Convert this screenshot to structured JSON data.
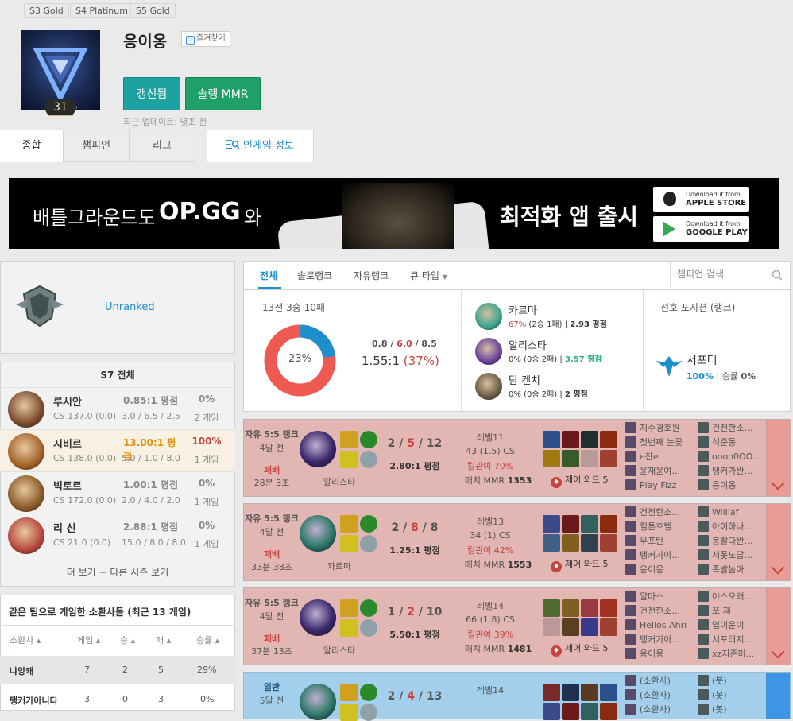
{
  "tier_tags": [
    "S3 Gold",
    "S4 Platinum",
    "S5 Gold"
  ],
  "profile": {
    "level": "31",
    "name": "응이옹",
    "favorite_label": "즐겨찾기",
    "refresh_label": "갱신됨",
    "mmr_label": "솔랭 MMR",
    "last_update": "최근 업데이트: 몇초 전"
  },
  "tabs": [
    "종합",
    "챔피언",
    "리그",
    "인게임 정보"
  ],
  "banner": {
    "text1": "배틀그라운드도",
    "text2": "OP.GG",
    "text3": "와",
    "text4": "최적화 앱 출시",
    "apple_small": "Download it from",
    "apple_big": "APPLE STORE",
    "google_small": "Download it from",
    "google_big": "GOOGLE PLAY"
  },
  "rank": {
    "status": "Unranked"
  },
  "season": {
    "title": "S7 전체",
    "champions": [
      {
        "name": "루시안",
        "cs": "CS 137.0 (0.0)",
        "kda": "0.85:1 평점",
        "kd": "3.0 / 6.5 / 2.5",
        "winrate": "0%",
        "games": "2 게임",
        "kda_color": "#888",
        "wr_color": "#888",
        "face": "#7a4a2e"
      },
      {
        "name": "시비르",
        "cs": "CS 138.0 (0.0)",
        "kda": "13.00:1 평점",
        "kd": "5.0 / 1.0 / 8.0",
        "winrate": "100%",
        "games": "1 게임",
        "kda_color": "#e19205",
        "wr_color": "#c6443e",
        "face": "#a4622a"
      },
      {
        "name": "빅토르",
        "cs": "CS 172.0 (0.0)",
        "kda": "1.00:1 평점",
        "kd": "2.0 / 4.0 / 2.0",
        "winrate": "0%",
        "games": "1 게임",
        "kda_color": "#888",
        "wr_color": "#888",
        "face": "#8a5a2a"
      },
      {
        "name": "리 신",
        "cs": "CS 21.0 (0.0)",
        "kda": "2.88:1 평점",
        "kd": "15.0 / 8.0 / 8.0",
        "winrate": "0%",
        "games": "1 게임",
        "kda_color": "#888",
        "wr_color": "#888",
        "face": "#b5463c"
      }
    ],
    "more_label": "더 보기 + 다른 시즌 보기"
  },
  "friends": {
    "title": "같은 팀으로 게임한 소환사들 (최근 13 게임)",
    "headers": [
      "소환사",
      "게임",
      "승",
      "패",
      "승률"
    ],
    "rows": [
      {
        "name": "냐앙캐",
        "games": "7",
        "wins": "2",
        "losses": "5",
        "winrate": "29%"
      },
      {
        "name": "탱커가아니다",
        "games": "3",
        "wins": "0",
        "losses": "3",
        "winrate": "0%"
      }
    ]
  },
  "filters": {
    "tabs": [
      "전체",
      "솔로랭크",
      "자유랭크",
      "큐 타입"
    ],
    "search_placeholder": "챔피언 검색"
  },
  "summary": {
    "record": "13전 3승 10패",
    "winrate_label": "23%",
    "winrate": 23,
    "kills": "0.8",
    "deaths": "6.0",
    "assists": "8.5",
    "ratio": "1.55:1",
    "kp": "(37%)",
    "top_champs": [
      {
        "name": "카르마",
        "wr": "67%",
        "detail": "(2승 1패)",
        "kda": "2.93 평점",
        "kda_color": "#333",
        "wr_color": "#c6443e"
      },
      {
        "name": "알리스타",
        "wr": "0%",
        "detail": "(0승 2패)",
        "kda": "3.57 평점",
        "kda_color": "#2daf7f",
        "wr_color": "#333"
      },
      {
        "name": "탐 켄치",
        "wr": "0%",
        "detail": "(0승 2패)",
        "kda": "2 평점",
        "kda_color": "#333",
        "wr_color": "#333"
      }
    ],
    "position_title": "선호 포지션 (랭크)",
    "position_name": "서포터",
    "position_rate": "100%",
    "position_win_label": "승률",
    "position_win": "0%"
  },
  "matches": [
    {
      "queue": "자유 5:5 랭크",
      "time": "4달 전",
      "result": "패배",
      "duration": "28분 3초",
      "champ": "알리스타",
      "k": "2",
      "d": "5",
      "a": "12",
      "ratio": "2.80:1 평점",
      "level": "레벨11",
      "cs": "43 (1.5) CS",
      "kp": "킬관여 70%",
      "mmr_label": "매치 MMR",
      "mmr": "1353",
      "ward": "제어 와드 5",
      "type": "loss",
      "team1": [
        "지수경호원",
        "첫번째 눈꽃",
        "e찬e",
        "윤재윤여...",
        "Play Fizz"
      ],
      "team2": [
        "건전한소...",
        "석준동",
        "oooo0OO...",
        "탱커가싼...",
        "응이옹"
      ]
    },
    {
      "queue": "자유 5:5 랭크",
      "time": "4달 전",
      "result": "패배",
      "duration": "33분 38초",
      "champ": "카르마",
      "k": "2",
      "d": "8",
      "a": "8",
      "ratio": "1.25:1 평점",
      "level": "레벨13",
      "cs": "34 (1) CS",
      "kp": "킬관여 42%",
      "mmr_label": "매치 MMR",
      "mmr": "1553",
      "ward": "제어 와드 5",
      "type": "loss",
      "team1": [
        "건전한소...",
        "힐튼호텔",
        "무포탄",
        "탱커가아...",
        "응이옹"
      ],
      "team2": [
        "Williaf",
        "아이하나...",
        "봉빨다싼...",
        "서폿노답...",
        "족발놈아"
      ]
    },
    {
      "queue": "자유 5:5 랭크",
      "time": "4달 전",
      "result": "패배",
      "duration": "37분 13초",
      "champ": "알리스타",
      "k": "1",
      "d": "2",
      "a": "10",
      "ratio": "5.50:1 평점",
      "level": "레벨14",
      "cs": "66 (1.8) CS",
      "kp": "킬관여 39%",
      "mmr_label": "매치 MMR",
      "mmr": "1481",
      "ward": "제어 와드 5",
      "type": "loss",
      "team1": [
        "알마스",
        "건전한소...",
        "Hellos Ahri",
        "탱커가아...",
        "응이옹"
      ],
      "team2": [
        "야스오왜...",
        "쪼 재",
        "엽이운이",
        "서포터지...",
        "xz지존미..."
      ]
    },
    {
      "queue": "일반",
      "time": "5달 전",
      "result": "",
      "duration": "",
      "champ": "",
      "k": "2",
      "d": "4",
      "a": "13",
      "ratio": "",
      "level": "레벨14",
      "cs": "",
      "kp": "",
      "mmr_label": "",
      "mmr": "",
      "ward": "",
      "type": "win",
      "team1": [
        "(소환사)",
        "(소환사)",
        "(소환사)"
      ],
      "team2": [
        "(봇)",
        "(봇)",
        "(봇)"
      ]
    }
  ]
}
